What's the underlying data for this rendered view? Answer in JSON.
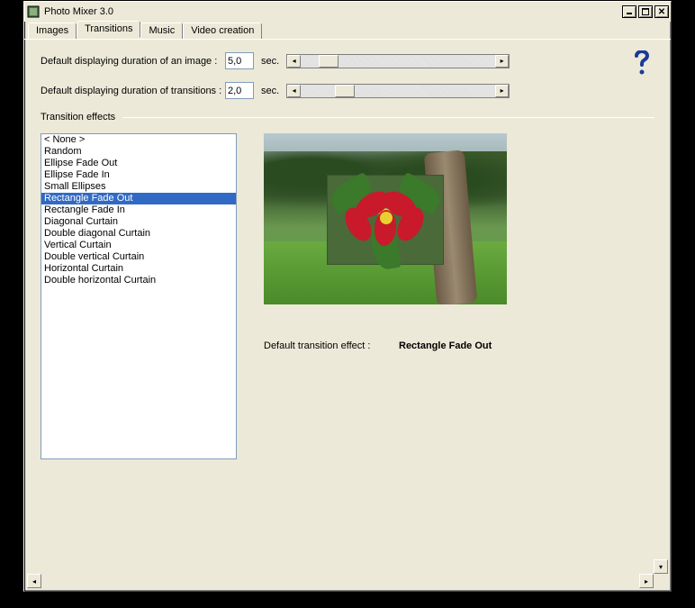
{
  "window": {
    "title": "Photo Mixer 3.0"
  },
  "tabs": [
    "Images",
    "Transitions",
    "Music",
    "Video creation"
  ],
  "active_tab": 1,
  "image_duration": {
    "label": "Default displaying duration of an image :",
    "value": "5,0",
    "unit": "sec."
  },
  "transition_duration": {
    "label": "Default displaying duration of transitions :",
    "value": "2,0",
    "unit": "sec."
  },
  "section_label": "Transition effects",
  "effects": [
    "< None >",
    "Random",
    "Ellipse Fade Out",
    "Ellipse Fade In",
    "Small Ellipses",
    "Rectangle Fade Out",
    "Rectangle Fade In",
    "Diagonal Curtain",
    "Double diagonal Curtain",
    "Vertical Curtain",
    "Double vertical Curtain",
    "Horizontal Curtain",
    "Double horizontal Curtain"
  ],
  "selected_effect_index": 5,
  "default_effect": {
    "label": "Default transition effect :",
    "value": "Rectangle Fade Out"
  }
}
